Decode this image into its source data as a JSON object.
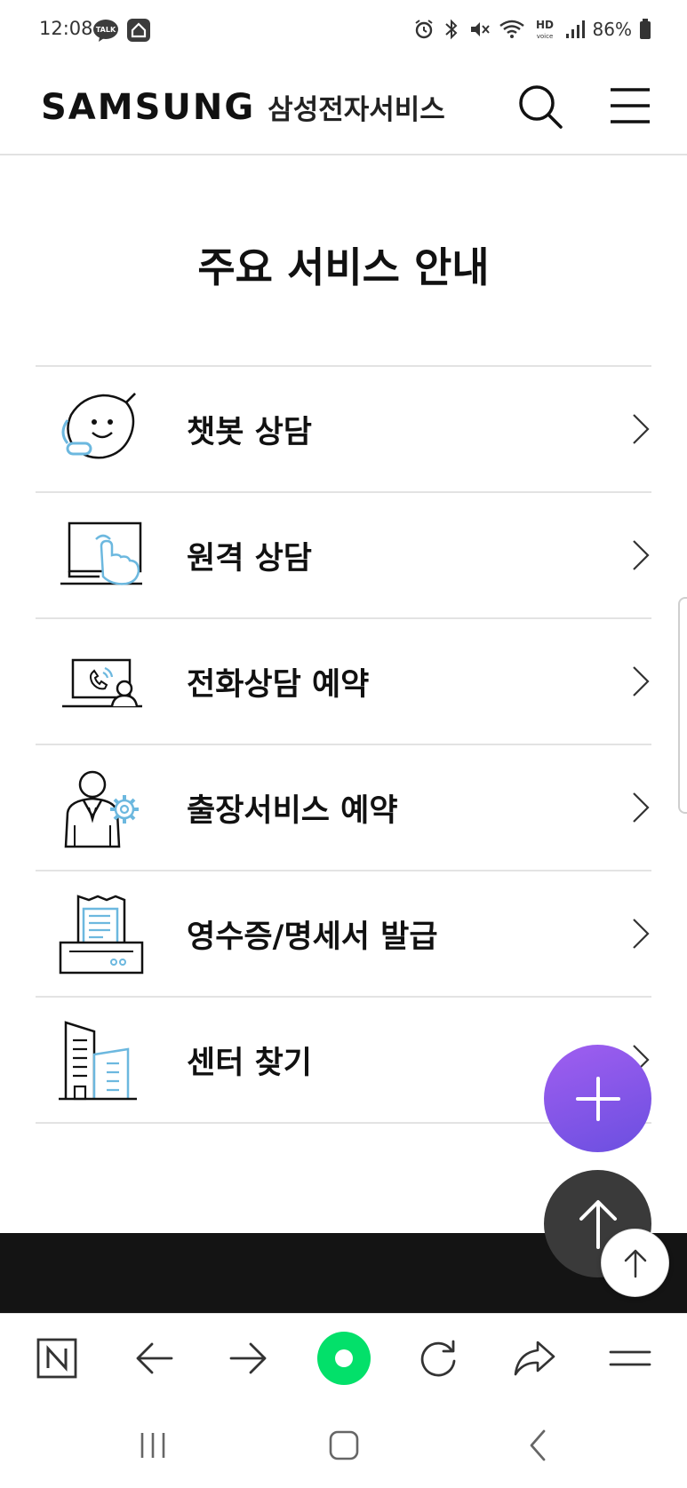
{
  "status_bar": {
    "time": "12:08",
    "talk_badge": "TALK",
    "battery": "86%",
    "hd_label": "HD",
    "voice_label": "voice"
  },
  "header": {
    "logo": "SAMSUNG",
    "service_name": "삼성전자서비스"
  },
  "page": {
    "title": "주요 서비스 안내"
  },
  "services": [
    {
      "label": "챗봇 상담",
      "icon": "chatbot-icon"
    },
    {
      "label": "원격 상담",
      "icon": "remote-support-icon"
    },
    {
      "label": "전화상담 예약",
      "icon": "phone-consult-icon"
    },
    {
      "label": "출장서비스 예약",
      "icon": "visit-service-icon"
    },
    {
      "label": "영수증/명세서 발급",
      "icon": "receipt-icon"
    },
    {
      "label": "센터 찾기",
      "icon": "building-icon"
    }
  ],
  "colors": {
    "accent_blue": "#6cb8df",
    "fab_purple": "#8757ea",
    "naver_green": "#03e06a"
  }
}
